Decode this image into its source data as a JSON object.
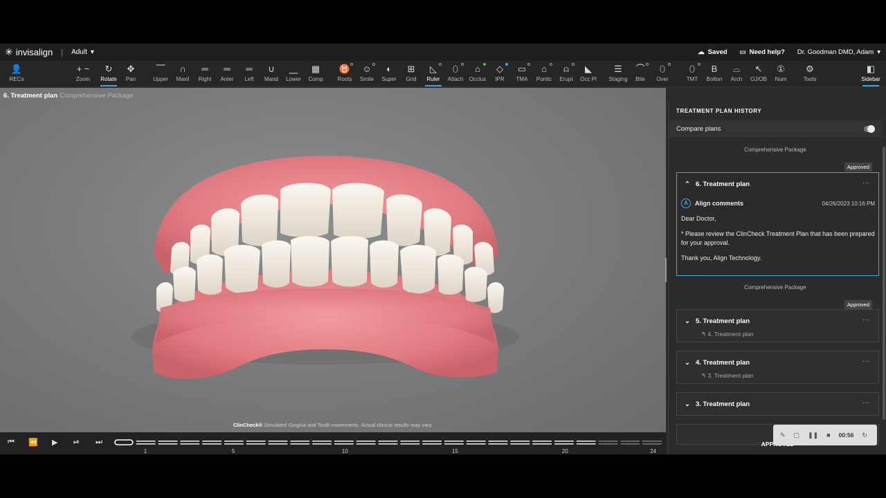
{
  "header": {
    "app_name": "invisalign",
    "mode": "Adult",
    "saved": "Saved",
    "help": "Need help?",
    "user": "Dr. Goodman DMD, Adam"
  },
  "toolbar": [
    {
      "label": "RECs",
      "icon": "person-icon",
      "glyph": "👤"
    },
    {
      "label": "Zoom",
      "icon": "zoom-icon",
      "glyph": "+ −"
    },
    {
      "label": "Rotate",
      "icon": "rotate-icon",
      "glyph": "↻",
      "active": true
    },
    {
      "label": "Pan",
      "icon": "pan-icon",
      "glyph": "✥"
    },
    {
      "label": "Upper",
      "icon": "upper-icon",
      "glyph": "⎺"
    },
    {
      "label": "Maxil",
      "icon": "maxil-icon",
      "glyph": "∩"
    },
    {
      "label": "Right",
      "icon": "right-icon",
      "glyph": "═"
    },
    {
      "label": "Anter",
      "icon": "anter-icon",
      "glyph": "═"
    },
    {
      "label": "Left",
      "icon": "left-icon",
      "glyph": "═"
    },
    {
      "label": "Mand",
      "icon": "mand-icon",
      "glyph": "∪"
    },
    {
      "label": "Lower",
      "icon": "lower-icon",
      "glyph": "⎽"
    },
    {
      "label": "Comp",
      "icon": "comp-icon",
      "glyph": "▦"
    },
    {
      "label": "Roots",
      "icon": "roots-icon",
      "glyph": "♉"
    },
    {
      "label": "Smile",
      "icon": "smile-icon",
      "glyph": "☺"
    },
    {
      "label": "Super",
      "icon": "super-icon",
      "glyph": "◐"
    },
    {
      "label": "Grid",
      "icon": "grid-icon",
      "glyph": "⊞"
    },
    {
      "label": "Ruler",
      "icon": "ruler-icon",
      "glyph": "◺",
      "active": true
    },
    {
      "label": "Attach",
      "icon": "attach-icon",
      "glyph": "⬯"
    },
    {
      "label": "Occlus",
      "icon": "occlus-icon",
      "glyph": "⌂"
    },
    {
      "label": "IPR",
      "icon": "ipr-icon",
      "glyph": "◇"
    },
    {
      "label": "TMA",
      "icon": "tma-icon",
      "glyph": "▭"
    },
    {
      "label": "Pontic",
      "icon": "pontic-icon",
      "glyph": "⌂"
    },
    {
      "label": "Erupt",
      "icon": "erupt-icon",
      "glyph": "⍝"
    },
    {
      "label": "Occ Pl",
      "icon": "occ-plane-icon",
      "glyph": "◣"
    },
    {
      "label": "Staging",
      "icon": "staging-icon",
      "glyph": "☰"
    },
    {
      "label": "Bite",
      "icon": "bite-icon",
      "glyph": "⌒"
    },
    {
      "label": "Over",
      "icon": "over-icon",
      "glyph": "⬯"
    },
    {
      "label": "TMT",
      "icon": "tmt-icon",
      "glyph": "⬯"
    },
    {
      "label": "Bolton",
      "icon": "bolton-icon",
      "glyph": "B"
    },
    {
      "label": "Arch",
      "icon": "arch-icon",
      "glyph": "⌓"
    },
    {
      "label": "OJ/OB",
      "icon": "ojob-icon",
      "glyph": "↖"
    },
    {
      "label": "Num",
      "icon": "num-icon",
      "glyph": "①"
    },
    {
      "label": "Tools",
      "icon": "gear-icon",
      "glyph": "⚙"
    },
    {
      "label": "Sidebar",
      "icon": "sidebar-icon",
      "glyph": "◧",
      "active": true
    }
  ],
  "viewport": {
    "plan_title": "6. Treatment plan",
    "package": "Comprehensive Package",
    "disclaimer_brand": "ClinCheck®",
    "disclaimer": "Simulated Gingiva and Tooth movements. Actual clinical results may vary."
  },
  "timeline": {
    "stage_labels": [
      "1",
      "5",
      "10",
      "15",
      "20",
      "24"
    ],
    "total_stages": 25,
    "current_stage": 0
  },
  "sidebar": {
    "title": "TREATMENT PLAN HISTORY",
    "compare_label": "Compare plans",
    "plans": [
      {
        "package": "Comprehensive Package",
        "status": "Approved",
        "title": "6. Treatment plan",
        "expanded": true,
        "comment": {
          "author_initial": "A",
          "author": "Align comments",
          "date": "04/26/2023 10:16 PM",
          "greeting": "Dear Doctor,",
          "body": "* Please review the ClinCheck Treatment Plan that has been prepared for your approval.",
          "signoff": "Thank you, Align Technology."
        }
      },
      {
        "package": "Comprehensive Package",
        "status": "Approved",
        "title": "5. Treatment plan",
        "parent": "4. Treatment plan"
      },
      {
        "title": "4. Treatment plan",
        "parent": "3. Treatment plan"
      },
      {
        "title": "3. Treatment plan"
      }
    ],
    "footer_status": "APPROVED"
  },
  "recorder": {
    "time": "00:56"
  },
  "colors": {
    "accent": "#3ea9e0",
    "gum": "#e07a7f",
    "tooth": "#f2ece2"
  }
}
